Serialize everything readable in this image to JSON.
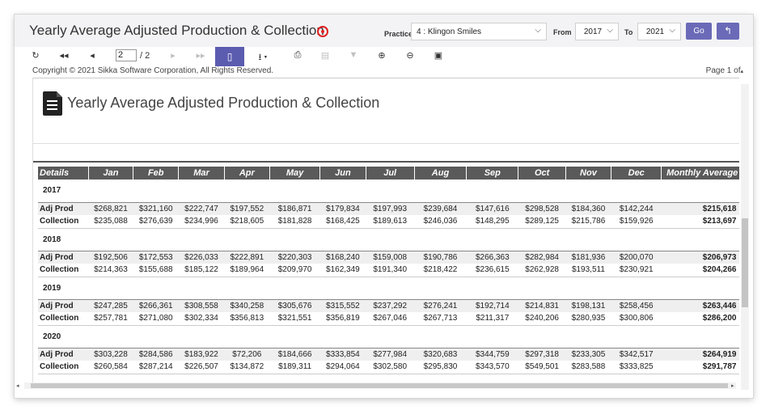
{
  "header": {
    "title": "Yearly Average Adjusted Production & Collection",
    "practice_label": "Practice",
    "practice_value": "4 :   Klingon Smiles",
    "from_label": "From",
    "from_value": "2017",
    "to_label": "To",
    "to_value": "2021",
    "go_label": "Go"
  },
  "toolbar": {
    "page_current": "2",
    "page_total": "/ 2"
  },
  "report": {
    "copyright": "Copyright © 2021 Sikka Software Corporation, All Rights Reserved.",
    "page_of": "Page 1 of",
    "title": "Yearly Average Adjusted Production & Collection"
  },
  "table": {
    "columns": [
      "Details",
      "Jan",
      "Feb",
      "Mar",
      "Apr",
      "May",
      "Jun",
      "Jul",
      "Aug",
      "Sep",
      "Oct",
      "Nov",
      "Dec",
      "Monthly Average"
    ],
    "years": [
      {
        "year": "2017",
        "rows": [
          {
            "label": "Adj Prod",
            "values": [
              "$268,821",
              "$321,160",
              "$222,747",
              "$197,552",
              "$186,871",
              "$179,834",
              "$197,993",
              "$239,684",
              "$147,616",
              "$298,528",
              "$184,360",
              "$142,244"
            ],
            "avg": "$215,618"
          },
          {
            "label": "Collection",
            "values": [
              "$235,088",
              "$276,639",
              "$234,996",
              "$218,605",
              "$181,828",
              "$168,425",
              "$189,613",
              "$246,036",
              "$148,295",
              "$289,125",
              "$215,786",
              "$159,926"
            ],
            "avg": "$213,697"
          }
        ]
      },
      {
        "year": "2018",
        "rows": [
          {
            "label": "Adj Prod",
            "values": [
              "$192,506",
              "$172,553",
              "$226,033",
              "$222,891",
              "$220,303",
              "$168,240",
              "$159,008",
              "$190,786",
              "$266,363",
              "$282,984",
              "$181,936",
              "$200,070"
            ],
            "avg": "$206,973"
          },
          {
            "label": "Collection",
            "values": [
              "$214,363",
              "$155,688",
              "$185,122",
              "$189,964",
              "$209,970",
              "$162,349",
              "$191,340",
              "$218,422",
              "$236,615",
              "$262,928",
              "$193,511",
              "$230,921"
            ],
            "avg": "$204,266"
          }
        ]
      },
      {
        "year": "2019",
        "rows": [
          {
            "label": "Adj Prod",
            "values": [
              "$247,285",
              "$266,361",
              "$308,558",
              "$340,258",
              "$305,676",
              "$315,552",
              "$237,292",
              "$276,241",
              "$192,714",
              "$214,831",
              "$198,131",
              "$258,456"
            ],
            "avg": "$263,446"
          },
          {
            "label": "Collection",
            "values": [
              "$257,781",
              "$271,080",
              "$302,334",
              "$356,813",
              "$321,551",
              "$356,819",
              "$267,046",
              "$267,713",
              "$211,317",
              "$240,206",
              "$280,935",
              "$300,806"
            ],
            "avg": "$286,200"
          }
        ]
      },
      {
        "year": "2020",
        "rows": [
          {
            "label": "Adj Prod",
            "values": [
              "$303,228",
              "$284,586",
              "$183,922",
              "$72,206",
              "$184,666",
              "$333,854",
              "$277,984",
              "$320,683",
              "$344,759",
              "$297,318",
              "$233,305",
              "$342,517"
            ],
            "avg": "$264,919"
          },
          {
            "label": "Collection",
            "values": [
              "$260,584",
              "$287,214",
              "$226,507",
              "$134,872",
              "$189,311",
              "$294,064",
              "$302,580",
              "$295,830",
              "$343,570",
              "$549,501",
              "$283,588",
              "$333,825"
            ],
            "avg": "$291,787"
          }
        ]
      }
    ]
  }
}
